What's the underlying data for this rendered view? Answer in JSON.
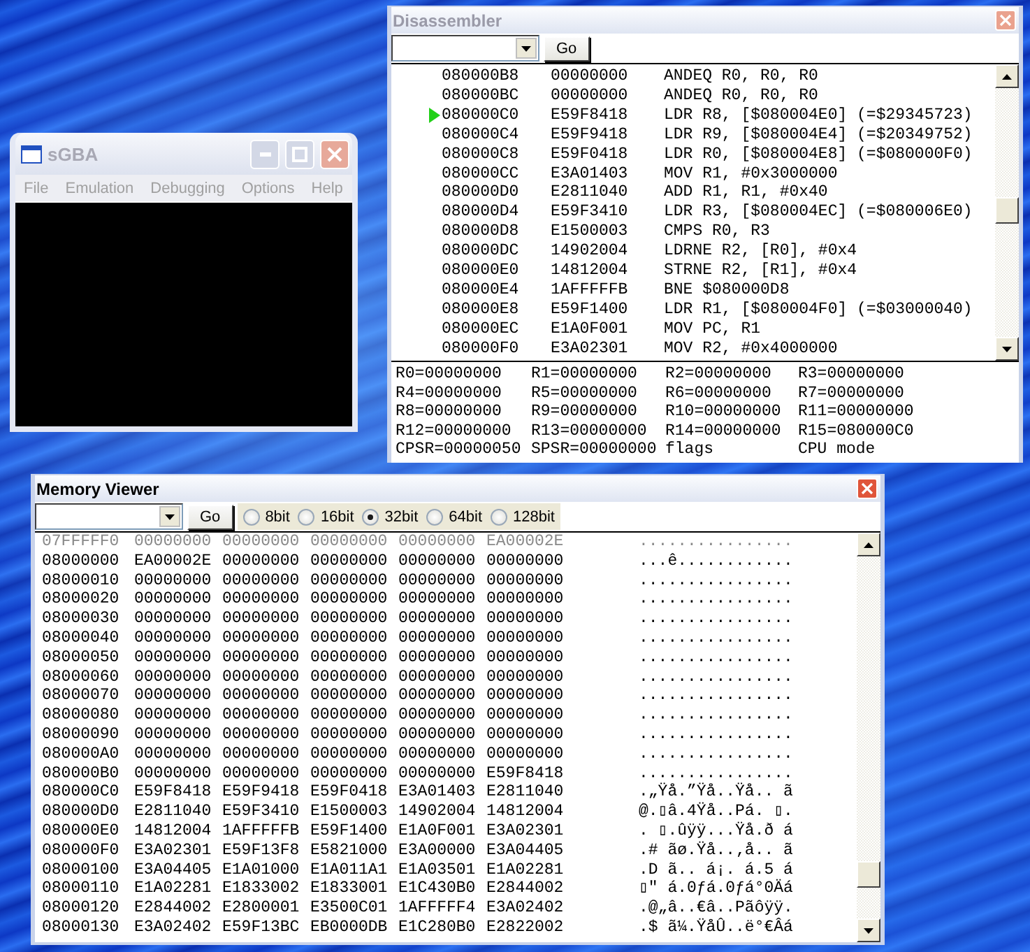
{
  "main_window": {
    "title": "sGBA",
    "active": false,
    "menu": [
      "File",
      "Emulation",
      "Debugging",
      "Options",
      "Help"
    ]
  },
  "disassembler": {
    "title": "Disassembler",
    "active": false,
    "go_button": "Go",
    "rows": [
      {
        "address": "080000B8",
        "opcode": "00000000",
        "instruction": "ANDEQ R0, R0, R0",
        "current": false
      },
      {
        "address": "080000BC",
        "opcode": "00000000",
        "instruction": "ANDEQ R0, R0, R0",
        "current": false
      },
      {
        "address": "080000C0",
        "opcode": "E59F8418",
        "instruction": "LDR R8, [$080004E0] (=$29345723)",
        "current": true
      },
      {
        "address": "080000C4",
        "opcode": "E59F9418",
        "instruction": "LDR R9, [$080004E4] (=$20349752)",
        "current": false
      },
      {
        "address": "080000C8",
        "opcode": "E59F0418",
        "instruction": "LDR R0, [$080004E8] (=$080000F0)",
        "current": false
      },
      {
        "address": "080000CC",
        "opcode": "E3A01403",
        "instruction": "MOV R1, #0x3000000",
        "current": false
      },
      {
        "address": "080000D0",
        "opcode": "E2811040",
        "instruction": "ADD R1, R1, #0x40",
        "current": false
      },
      {
        "address": "080000D4",
        "opcode": "E59F3410",
        "instruction": "LDR R3, [$080004EC] (=$080006E0)",
        "current": false
      },
      {
        "address": "080000D8",
        "opcode": "E1500003",
        "instruction": "CMPS R0, R3",
        "current": false
      },
      {
        "address": "080000DC",
        "opcode": "14902004",
        "instruction": "LDRNE R2, [R0], #0x4",
        "current": false
      },
      {
        "address": "080000E0",
        "opcode": "14812004",
        "instruction": "STRNE R2, [R1], #0x4",
        "current": false
      },
      {
        "address": "080000E4",
        "opcode": "1AFFFFFB",
        "instruction": "BNE $080000D8",
        "current": false
      },
      {
        "address": "080000E8",
        "opcode": "E59F1400",
        "instruction": "LDR R1, [$080004F0] (=$03000040)",
        "current": false
      },
      {
        "address": "080000EC",
        "opcode": "E1A0F001",
        "instruction": "MOV PC, R1",
        "current": false
      },
      {
        "address": "080000F0",
        "opcode": "E3A02301",
        "instruction": "MOV R2, #0x4000000",
        "current": false
      }
    ],
    "registers": [
      [
        "R0=00000000",
        "R1=00000000",
        "R2=00000000",
        "R3=00000000"
      ],
      [
        "R4=00000000",
        "R5=00000000",
        "R6=00000000",
        "R7=00000000"
      ],
      [
        "R8=00000000",
        "R9=00000000",
        "R10=00000000",
        "R11=00000000"
      ],
      [
        "R12=00000000",
        "R13=00000000",
        "R14=00000000",
        "R15=080000C0"
      ],
      [
        "CPSR=00000050",
        "SPSR=00000000",
        "flags",
        "CPU mode"
      ]
    ]
  },
  "memory_viewer": {
    "title": "Memory Viewer",
    "active": true,
    "go_button": "Go",
    "widths": [
      {
        "label": "8bit",
        "selected": false
      },
      {
        "label": "16bit",
        "selected": false
      },
      {
        "label": "32bit",
        "selected": true
      },
      {
        "label": "64bit",
        "selected": false
      },
      {
        "label": "128bit",
        "selected": false
      }
    ],
    "rows": [
      {
        "address": "07FFFFF0",
        "values": [
          "00000000",
          "00000000",
          "00000000",
          "00000000",
          "EA00002E"
        ],
        "ascii": "................",
        "dimmed": true
      },
      {
        "address": "08000000",
        "values": [
          "EA00002E",
          "00000000",
          "00000000",
          "00000000",
          "00000000"
        ],
        "ascii": "...ê............",
        "dimmed": false
      },
      {
        "address": "08000010",
        "values": [
          "00000000",
          "00000000",
          "00000000",
          "00000000",
          "00000000"
        ],
        "ascii": "................",
        "dimmed": false
      },
      {
        "address": "08000020",
        "values": [
          "00000000",
          "00000000",
          "00000000",
          "00000000",
          "00000000"
        ],
        "ascii": "................",
        "dimmed": false
      },
      {
        "address": "08000030",
        "values": [
          "00000000",
          "00000000",
          "00000000",
          "00000000",
          "00000000"
        ],
        "ascii": "................",
        "dimmed": false
      },
      {
        "address": "08000040",
        "values": [
          "00000000",
          "00000000",
          "00000000",
          "00000000",
          "00000000"
        ],
        "ascii": "................",
        "dimmed": false
      },
      {
        "address": "08000050",
        "values": [
          "00000000",
          "00000000",
          "00000000",
          "00000000",
          "00000000"
        ],
        "ascii": "................",
        "dimmed": false
      },
      {
        "address": "08000060",
        "values": [
          "00000000",
          "00000000",
          "00000000",
          "00000000",
          "00000000"
        ],
        "ascii": "................",
        "dimmed": false
      },
      {
        "address": "08000070",
        "values": [
          "00000000",
          "00000000",
          "00000000",
          "00000000",
          "00000000"
        ],
        "ascii": "................",
        "dimmed": false
      },
      {
        "address": "08000080",
        "values": [
          "00000000",
          "00000000",
          "00000000",
          "00000000",
          "00000000"
        ],
        "ascii": "................",
        "dimmed": false
      },
      {
        "address": "08000090",
        "values": [
          "00000000",
          "00000000",
          "00000000",
          "00000000",
          "00000000"
        ],
        "ascii": "................",
        "dimmed": false
      },
      {
        "address": "080000A0",
        "values": [
          "00000000",
          "00000000",
          "00000000",
          "00000000",
          "00000000"
        ],
        "ascii": "................",
        "dimmed": false
      },
      {
        "address": "080000B0",
        "values": [
          "00000000",
          "00000000",
          "00000000",
          "00000000",
          "E59F8418"
        ],
        "ascii": "................",
        "dimmed": false
      },
      {
        "address": "080000C0",
        "values": [
          "E59F8418",
          "E59F9418",
          "E59F0418",
          "E3A01403",
          "E2811040"
        ],
        "ascii": ".„Ÿå.”Ÿå..Ÿå.. ã",
        "dimmed": false
      },
      {
        "address": "080000D0",
        "values": [
          "E2811040",
          "E59F3410",
          "E1500003",
          "14902004",
          "14812004"
        ],
        "ascii": "@.▯â.4Ÿå..Pá. ▯.",
        "dimmed": false
      },
      {
        "address": "080000E0",
        "values": [
          "14812004",
          "1AFFFFFB",
          "E59F1400",
          "E1A0F001",
          "E3A02301"
        ],
        "ascii": ". ▯.ûÿÿ...Ÿå.ð á",
        "dimmed": false
      },
      {
        "address": "080000F0",
        "values": [
          "E3A02301",
          "E59F13F8",
          "E5821000",
          "E3A00000",
          "E3A04405"
        ],
        "ascii": ".# ãø.Ÿå..‚å.. ã",
        "dimmed": false
      },
      {
        "address": "08000100",
        "values": [
          "E3A04405",
          "E1A01000",
          "E1A011A1",
          "E1A03501",
          "E1A02281"
        ],
        "ascii": ".D ã.. á¡. á.5 á",
        "dimmed": false
      },
      {
        "address": "08000110",
        "values": [
          "E1A02281",
          "E1833002",
          "E1833001",
          "E1C430B0",
          "E2844002"
        ],
        "ascii": "▯\" á.0ƒá.0ƒá°0Äá",
        "dimmed": false
      },
      {
        "address": "08000120",
        "values": [
          "E2844002",
          "E2800001",
          "E3500C01",
          "1AFFFFF4",
          "E3A02402"
        ],
        "ascii": ".@„â..€â..Pãôÿÿ.",
        "dimmed": false
      },
      {
        "address": "08000130",
        "values": [
          "E3A02402",
          "E59F13BC",
          "EB0000DB",
          "E1C280B0",
          "E2822002"
        ],
        "ascii": ".$ ã¼.ŸåÛ..ë°€Âá",
        "dimmed": false
      }
    ]
  }
}
